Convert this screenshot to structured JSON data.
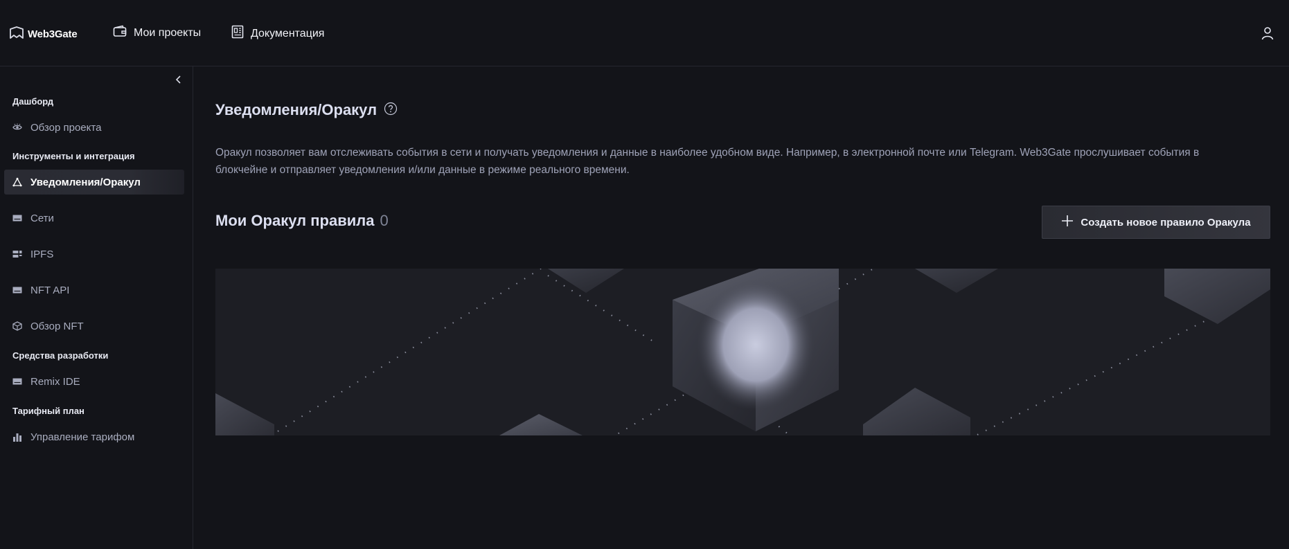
{
  "header": {
    "logo_text": "Web3Gate",
    "nav": {
      "projects": "Мои проекты",
      "docs": "Документация"
    }
  },
  "sidebar": {
    "sections": {
      "dashboard": "Дашборд",
      "tools": "Инструменты и интеграция",
      "dev": "Средства разработки",
      "plan": "Тарифный план"
    },
    "items": [
      {
        "label": "Обзор проекта",
        "icon": "eye-icon"
      },
      {
        "label": "Уведомления/Оракул",
        "icon": "triangle-nodes-icon",
        "active": true
      },
      {
        "label": "Сети",
        "icon": "server-icon"
      },
      {
        "label": "IPFS",
        "icon": "grid-icon"
      },
      {
        "label": "NFT API",
        "icon": "server-icon"
      },
      {
        "label": "Обзор NFT",
        "icon": "cube-icon"
      },
      {
        "label": "Remix IDE",
        "icon": "server-icon"
      },
      {
        "label": "Управление тарифом",
        "icon": "bar-chart-icon"
      }
    ]
  },
  "main": {
    "title": "Уведомления/Оракул",
    "description": "Оракул позволяет вам отслеживать события в сети и получать уведомления и данные в наиболее удобном виде. Например, в электронной почте или Telegram. Web3Gate прослушивает события в блокчейне и отправляет уведомления и/или данные в режиме реального времени.",
    "rules_title": "Мои Оракул правила",
    "rules_count": "0",
    "create_button": "Создать новое правило Оракула"
  },
  "colors": {
    "background": "#131419",
    "accent_text": "#dcdff0",
    "muted_text": "#9fa3b8",
    "active_bg": "#2a2b33"
  }
}
